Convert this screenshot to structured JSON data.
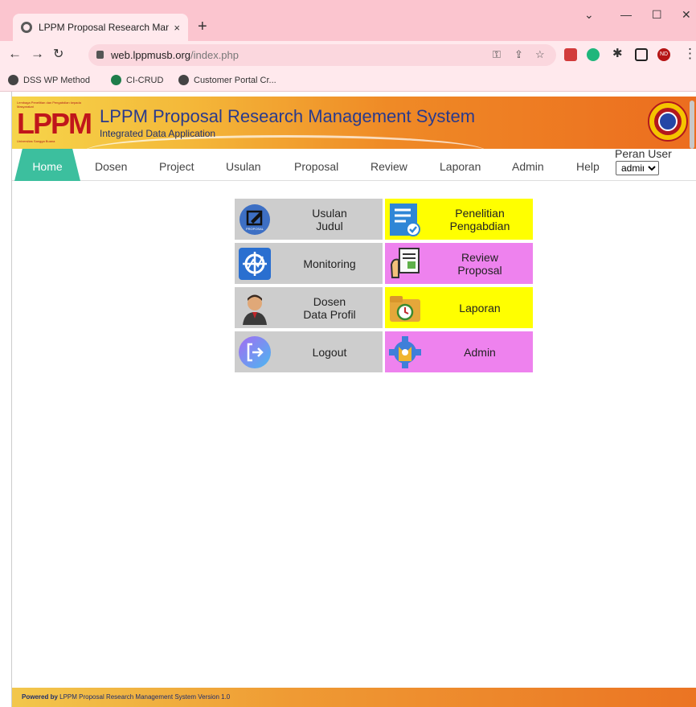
{
  "browser": {
    "tab_title": "LPPM Proposal Research Manage",
    "tab_close": "×",
    "new_tab": "+",
    "url_host": "web.lppmusb.org",
    "url_path": "/index.php",
    "bookmarks": [
      "DSS WP Method",
      "CI-CRUD",
      "Customer Portal Cr..."
    ],
    "profile_initials": "ND"
  },
  "header": {
    "logo_text": "LPPM",
    "logo_top": "Lembaga Penelitian dan Pengabdian kepada Masyarakat",
    "logo_bottom": "Universitas Sangga Buana",
    "title": "LPPM Proposal Research Management System",
    "subtitle": "Integrated Data Application",
    "emblem_text": "UNIVERSITAS SANGGA BUANA YPKP"
  },
  "menu": {
    "items": [
      "Home",
      "Dosen",
      "Project",
      "Usulan",
      "Proposal",
      "Review",
      "Laporan",
      "Admin",
      "Help"
    ],
    "role_label": "Peran User",
    "role_value": "admin"
  },
  "tiles": [
    {
      "label": "Usulan\nJudul",
      "color": "#cdcdcd",
      "icon": "edit-icon",
      "icon_caption": "PROPOSAL"
    },
    {
      "label": "Penelitian\nPengabdian",
      "color": "#ffff00",
      "icon": "checklist-icon"
    },
    {
      "label": "Monitoring",
      "color": "#cdcdcd",
      "icon": "monitoring-icon"
    },
    {
      "label": "Review\nProposal",
      "color": "#ee82ee",
      "icon": "document-review-icon"
    },
    {
      "label": "Dosen\nData Profil",
      "color": "#cdcdcd",
      "icon": "person-icon"
    },
    {
      "label": "Laporan",
      "color": "#ffff00",
      "icon": "folder-clock-icon"
    },
    {
      "label": "Logout",
      "color": "#cdcdcd",
      "icon": "logout-icon"
    },
    {
      "label": "Admin",
      "color": "#ee82ee",
      "icon": "gear-icon"
    }
  ],
  "footer": {
    "powered": "Powered by",
    "text": "LPPM Proposal Research Management System Version 1.0"
  }
}
